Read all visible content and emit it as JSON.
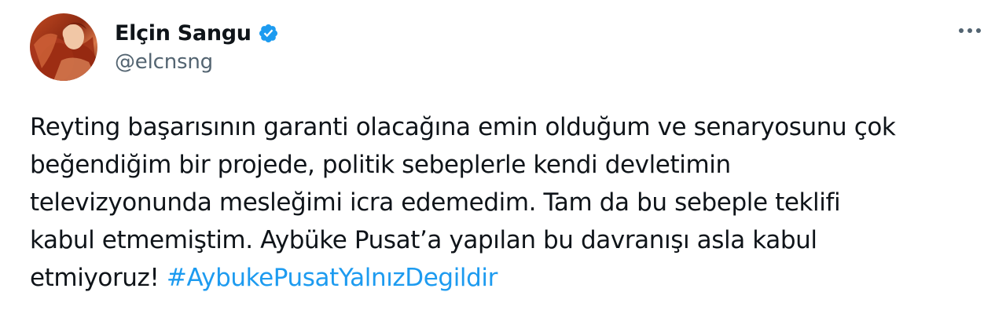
{
  "author": {
    "display_name": "Elçin Sangu",
    "handle": "@elcnsng",
    "verified": true
  },
  "tweet": {
    "text_lines": [
      "Reyting başarısının garanti olacağına emin olduğum ve senaryosunu çok",
      "beğendiğim  bir projede, politik sebeplerle kendi devletimin",
      "televizyonunda mesleğimi icra edemedim. Tam da bu sebeple teklifi",
      "kabul etmemiştim. Aybüke Pusat’a yapılan bu davranışı asla kabul",
      "etmiyoruz! "
    ],
    "hashtag": "#AybukePusatYalnızDegildir"
  },
  "icons": {
    "verified": "verified-badge-icon",
    "more": "more-options-icon"
  },
  "colors": {
    "text": "#0f1419",
    "secondary": "#536471",
    "accent": "#1d9bf0"
  }
}
